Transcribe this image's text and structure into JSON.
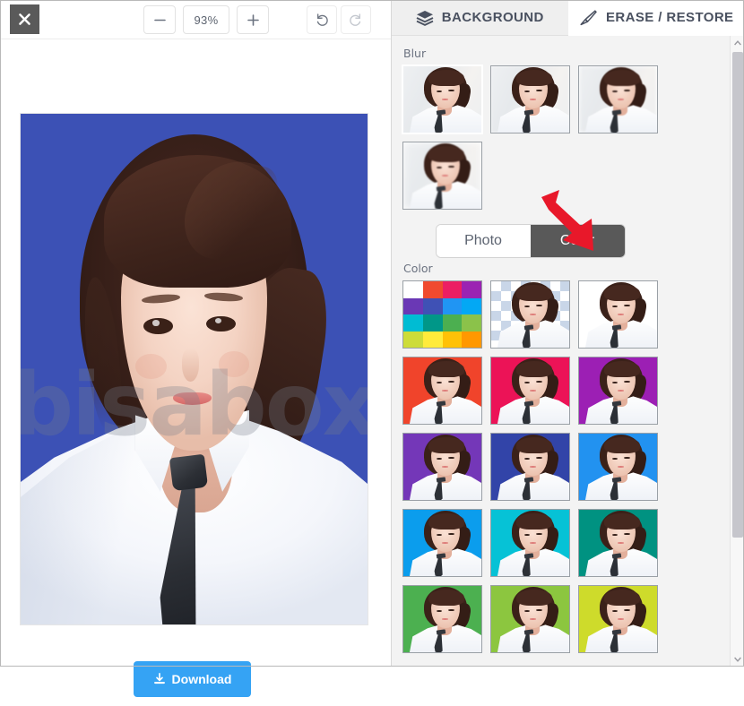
{
  "editor": {
    "close_label": "×",
    "zoom": {
      "minus_label": "−",
      "level": "93%",
      "plus_label": "+"
    },
    "history": {
      "undo_label": "undo-icon",
      "redo_label": "redo-icon"
    },
    "download_label": "Download",
    "watermark_text": "bisabox",
    "canvas_bg_color": "#3c51b5"
  },
  "panel": {
    "tabs": [
      {
        "label": "BACKGROUND",
        "icon": "layers-icon",
        "active": false
      },
      {
        "label": "ERASE / RESTORE",
        "icon": "brush-icon",
        "active": true
      }
    ],
    "blur": {
      "label": "Blur",
      "items": [
        {
          "name": "blur-none",
          "selected": true
        },
        {
          "name": "blur-light",
          "selected": false
        },
        {
          "name": "blur-medium",
          "selected": false
        },
        {
          "name": "blur-strong",
          "selected": false
        }
      ]
    },
    "mode_toggle": {
      "photo_label": "Photo",
      "color_label": "Color",
      "selected": "Color"
    },
    "color": {
      "label": "Color",
      "picker_palette": [
        "#ffffff",
        "#f04a2f",
        "#ec1e63",
        "#9b23b2",
        "#6a38b5",
        "#3f51b5",
        "#2095f3",
        "#03a8f4",
        "#00bcd3",
        "#009788",
        "#4caf50",
        "#8bc24a",
        "#cddc39",
        "#ffeb3b",
        "#ffc107",
        "#ff9800"
      ],
      "swatches": [
        {
          "name": "color-picker",
          "color": "picker"
        },
        {
          "name": "transparent",
          "color": "transparent"
        },
        {
          "name": "white",
          "color": "#ffffff"
        },
        {
          "name": "red-orange",
          "color": "#f0442b"
        },
        {
          "name": "pink",
          "color": "#ec1357"
        },
        {
          "name": "purple",
          "color": "#9c1fb4"
        },
        {
          "name": "deep-purple",
          "color": "#7437b8"
        },
        {
          "name": "indigo",
          "color": "#3244a8"
        },
        {
          "name": "light-blue",
          "color": "#2292f0"
        },
        {
          "name": "blue",
          "color": "#0b9ded"
        },
        {
          "name": "cyan",
          "color": "#06c2d6"
        },
        {
          "name": "teal",
          "color": "#009281"
        },
        {
          "name": "green",
          "color": "#4cb050"
        },
        {
          "name": "light-green",
          "color": "#8cc63f"
        },
        {
          "name": "lime",
          "color": "#cedb2b"
        }
      ]
    },
    "scrollbar": {
      "up_label": "▲",
      "down_label": "▼"
    }
  },
  "annotation": {
    "arrow_color": "#e8182a",
    "points_at": "Color"
  }
}
